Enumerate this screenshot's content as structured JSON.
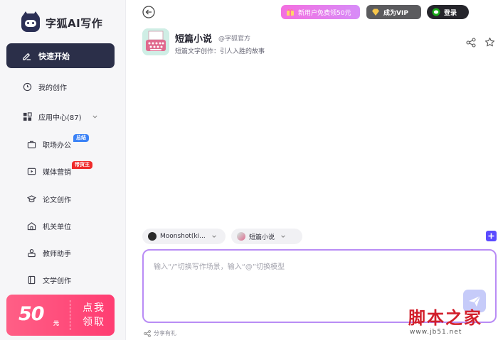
{
  "sidebar": {
    "brand": "字狐AI写作",
    "primary_action": "快速开始",
    "items": [
      {
        "label": "我的创作"
      },
      {
        "label": "应用中心(87)"
      }
    ],
    "sub_items": [
      {
        "label": "职场办公",
        "badge": "总结"
      },
      {
        "label": "媒体营销",
        "badge": "带货王"
      },
      {
        "label": "论文创作"
      },
      {
        "label": "机关单位"
      },
      {
        "label": "教师助手"
      },
      {
        "label": "文学创作"
      }
    ],
    "promo": {
      "amount": "50",
      "unit": "元",
      "cta": "点我领取"
    }
  },
  "topbar": {
    "new_user": "新用户免费领50元",
    "vip": "成为VIP",
    "login": "登录"
  },
  "app": {
    "title": "短篇小说",
    "author": "@字狐官方",
    "description": "短篇文字创作：引人入胜的故事"
  },
  "composer": {
    "model": "Moonshot(ki...",
    "scene": "短篇小说",
    "placeholder": "输入“/”切换写作场景，输入“@”切换模型",
    "share": "分享有礼"
  },
  "watermark": {
    "title": "脚本之家",
    "url": "www.jb51.net"
  },
  "colors": {
    "primary_dark": "#2b2f49",
    "accent_purple": "#b98cf5",
    "promo_pink": "#ff3d72",
    "send": "#c6cbf9"
  }
}
